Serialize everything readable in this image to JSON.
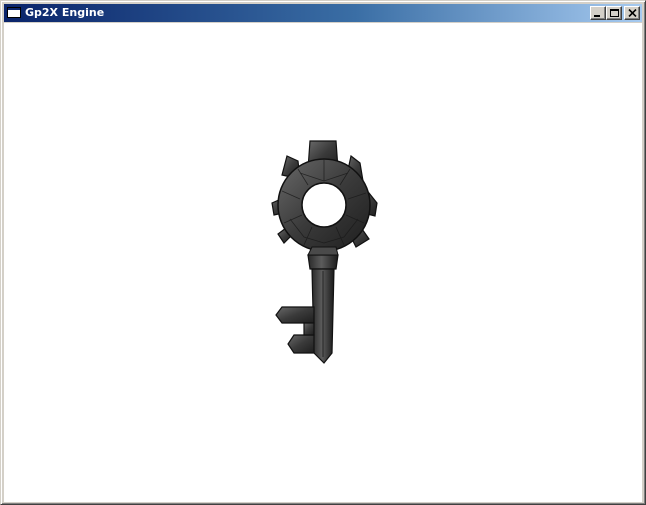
{
  "window": {
    "title": "Gp2X Engine",
    "icon": "app-window-icon",
    "controls": {
      "minimize_icon": "minimize-icon",
      "maximize_icon": "maximize-icon",
      "close_icon": "close-icon"
    }
  },
  "viewport": {
    "background": "#ffffff",
    "model": "key-3d-model"
  }
}
